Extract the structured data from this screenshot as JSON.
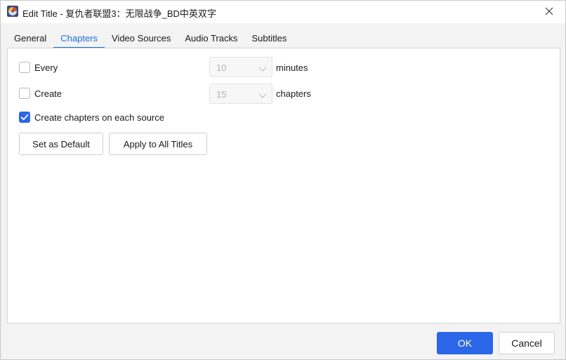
{
  "window": {
    "title": "Edit Title - 复仇者联盟3：无限战争_BD中英双字"
  },
  "tabs": [
    {
      "label": "General",
      "active": false
    },
    {
      "label": "Chapters",
      "active": true
    },
    {
      "label": "Video Sources",
      "active": false
    },
    {
      "label": "Audio Tracks",
      "active": false
    },
    {
      "label": "Subtitles",
      "active": false
    }
  ],
  "chapters": {
    "every": {
      "label": "Every",
      "checked": false,
      "value": "10",
      "unit": "minutes"
    },
    "create": {
      "label": "Create",
      "checked": false,
      "value": "15",
      "unit": "chapters"
    },
    "each_source": {
      "label": "Create chapters on each source",
      "checked": true
    },
    "set_default_label": "Set as Default",
    "apply_all_label": "Apply to All Titles"
  },
  "footer": {
    "ok_label": "OK",
    "cancel_label": "Cancel"
  },
  "colors": {
    "accent": "#2c66e8",
    "tab_active": "#1a6fd4"
  },
  "icons": {
    "app": "app-disc-icon",
    "close": "close-icon",
    "combo_arrow": "chevron-down-icon",
    "check": "checkmark-icon"
  }
}
